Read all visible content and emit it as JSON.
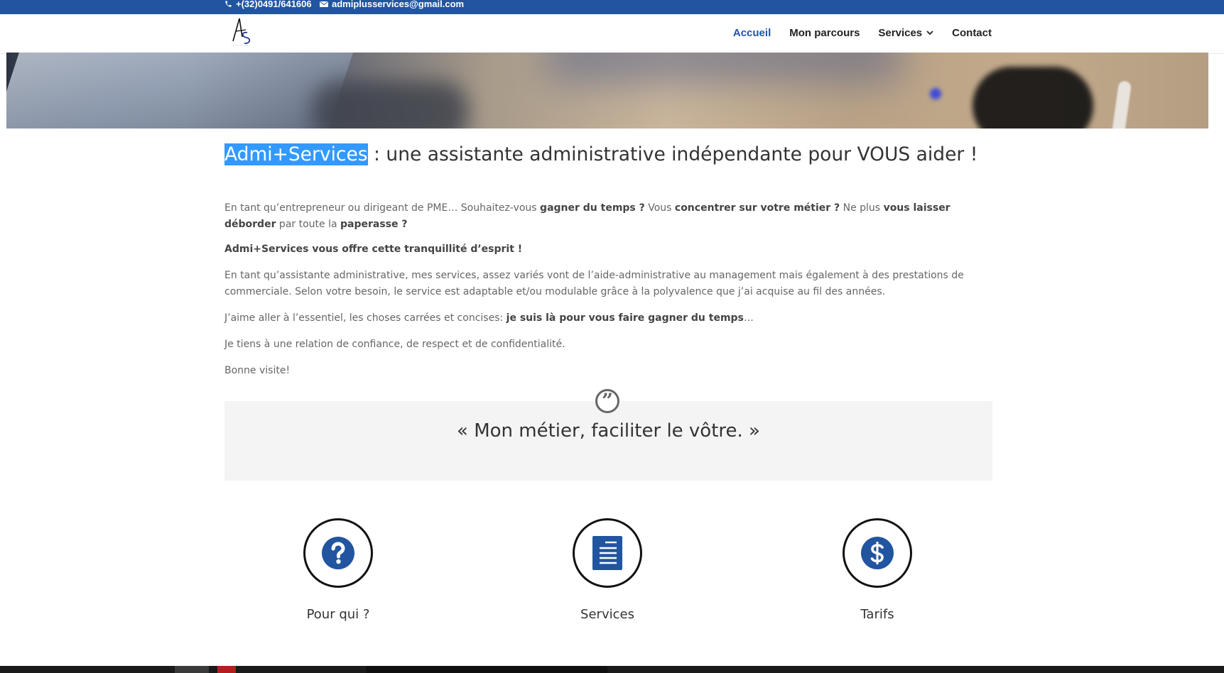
{
  "topbar": {
    "phone": "+(32)0491/641606",
    "email": "admiplusservices@gmail.com"
  },
  "nav": {
    "items": [
      {
        "label": "Accueil"
      },
      {
        "label": "Mon parcours"
      },
      {
        "label": "Services"
      },
      {
        "label": "Contact"
      }
    ]
  },
  "main": {
    "headline_brand": "Admi+Services",
    "headline_rest": " : une assistante administrative indépendante pour VOUS aider !",
    "p1": {
      "t1": "En tant qu’entrepreneur ou dirigeant de PME… Souhaitez-vous ",
      "b1": "gagner du temps ?",
      "t2": " Vous ",
      "b2": "concentrer sur votre métier ?",
      "t3": " Ne plus ",
      "b3": "vous laisser déborder",
      "t4": " par toute la ",
      "b4": "paperasse ?"
    },
    "p2": "Admi+Services vous offre cette tranquillité d’esprit  !",
    "p3": "En tant qu’assistante administrative, mes services, assez variés vont de l’aide-administrative au management mais également à des prestations de commerciale. Selon votre besoin, le service est adaptable et/ou modulable grâce à la polyvalence que j’ai acquise au fil des années.",
    "p4": {
      "t1": "J’aime aller à l’essentiel, les choses carrées et concises: ",
      "b1": "je suis là pour vous faire gagner du temps",
      "t2": "…"
    },
    "p5": "Je tiens à une relation de confiance, de respect et de confidentialité.",
    "p6": "Bonne visite!"
  },
  "quote": {
    "icon": "quote-icon",
    "text": "« Mon métier, faciliter le vôtre. »"
  },
  "features": [
    {
      "icon": "question-icon",
      "label": "Pour qui ?"
    },
    {
      "icon": "document-icon",
      "label": "Services"
    },
    {
      "icon": "dollar-icon",
      "label": "Tarifs"
    }
  ],
  "colors": {
    "brand": "#2255a0",
    "selection": "#3399ff",
    "quote_bg": "#f4f4f4"
  }
}
